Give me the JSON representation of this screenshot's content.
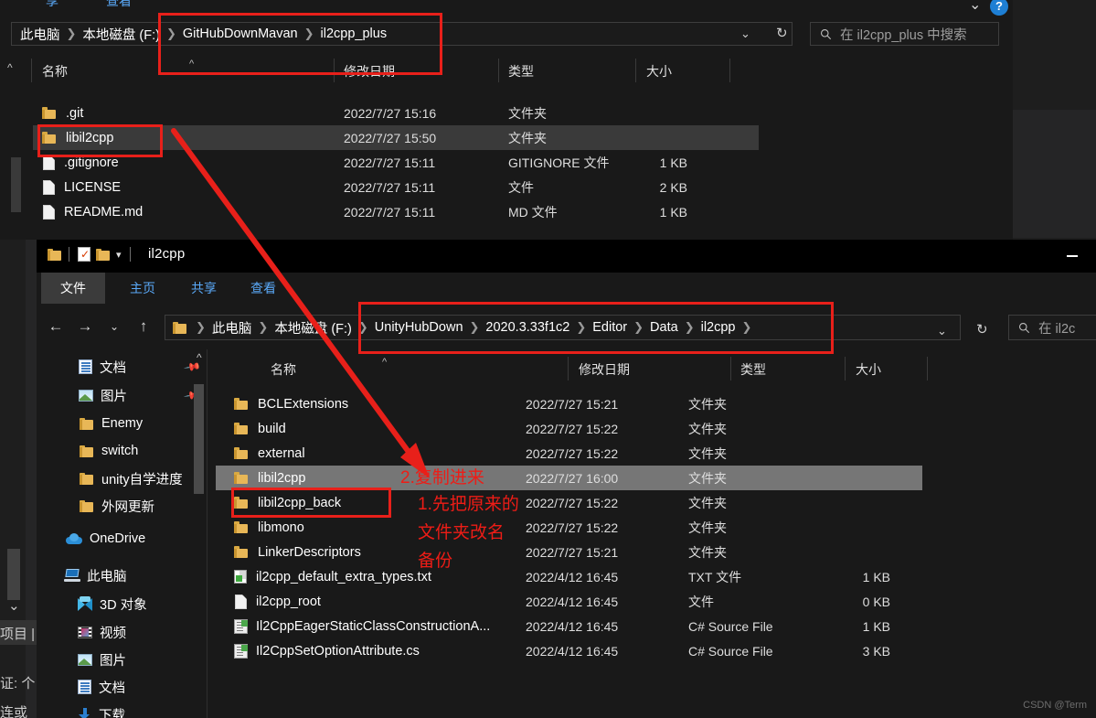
{
  "meta": {
    "watermark": "CSDN @Term"
  },
  "backdrop": {
    "edge_fragments": [
      {
        "text": "项目  |"
      },
      {
        "text": "证: 个"
      },
      {
        "text": "连或"
      }
    ]
  },
  "window_top": {
    "ribbon_tabs_visible": [
      "享",
      "查看"
    ],
    "help_icon": "?",
    "chevron_icon": "chevron-down-icon",
    "breadcrumbs": [
      "此电脑",
      "本地磁盘 (F:)",
      "GitHubDownMavan",
      "il2cpp_plus"
    ],
    "address_dropdown_icon": "chevron-down-icon",
    "refresh_icon": "refresh-icon",
    "search": {
      "icon": "search-icon",
      "placeholder": "在 il2cpp_plus 中搜索"
    },
    "columns": [
      "名称",
      "修改日期",
      "类型",
      "大小"
    ],
    "sort_indicator": "^",
    "rows": [
      {
        "name": ".git",
        "icon": "folder-icon",
        "date": "2022/7/27 15:16",
        "type": "文件夹",
        "size": "",
        "selected": false
      },
      {
        "name": "libil2cpp",
        "icon": "folder-icon",
        "date": "2022/7/27 15:50",
        "type": "文件夹",
        "size": "",
        "selected": true
      },
      {
        "name": ".gitignore",
        "icon": "file-icon",
        "date": "2022/7/27 15:11",
        "type": "GITIGNORE 文件",
        "size": "1 KB",
        "selected": false
      },
      {
        "name": "LICENSE",
        "icon": "file-icon",
        "date": "2022/7/27 15:11",
        "type": "文件",
        "size": "2 KB",
        "selected": false
      },
      {
        "name": "README.md",
        "icon": "file-icon",
        "date": "2022/7/27 15:11",
        "type": "MD 文件",
        "size": "1 KB",
        "selected": false
      }
    ]
  },
  "window_bottom": {
    "title": "il2cpp",
    "minimize_label": "—",
    "quick_access": [
      "folder-icon",
      "properties-icon",
      "new-folder-icon",
      "chevron-down-icon"
    ],
    "ribbon_tabs": [
      {
        "label": "文件",
        "active": true
      },
      {
        "label": "主页",
        "active": false
      },
      {
        "label": "共享",
        "active": false
      },
      {
        "label": "查看",
        "active": false
      }
    ],
    "nav_buttons": [
      "back-arrow-icon",
      "forward-arrow-icon",
      "recent-locations-icon",
      "up-arrow-icon"
    ],
    "breadcrumbs": [
      "此电脑",
      "本地磁盘 (F:)",
      "UnityHubDown",
      "2020.3.33f1c2",
      "Editor",
      "Data",
      "il2cpp"
    ],
    "address_dropdown_icon": "chevron-down-icon",
    "refresh_icon": "refresh-icon",
    "search": {
      "icon": "search-icon",
      "placeholder": "在 il2c"
    },
    "sidebar": [
      {
        "label": "文档",
        "icon": "documents-icon",
        "pinned": true,
        "indent": 1
      },
      {
        "label": "图片",
        "icon": "pictures-icon",
        "pinned": true,
        "indent": 1
      },
      {
        "label": "Enemy",
        "icon": "folder-icon",
        "pinned": false,
        "indent": 1
      },
      {
        "label": "switch",
        "icon": "folder-icon",
        "pinned": false,
        "indent": 1
      },
      {
        "label": "unity自学进度",
        "icon": "folder-icon",
        "pinned": false,
        "indent": 1
      },
      {
        "label": "外网更新",
        "icon": "folder-icon",
        "pinned": false,
        "indent": 1
      },
      {
        "label": "OneDrive",
        "icon": "onedrive-icon",
        "pinned": false,
        "indent": 0
      },
      {
        "label": "此电脑",
        "icon": "this-pc-icon",
        "pinned": false,
        "indent": 0
      },
      {
        "label": "3D 对象",
        "icon": "3d-objects-icon",
        "pinned": false,
        "indent": 1
      },
      {
        "label": "视频",
        "icon": "videos-icon",
        "pinned": false,
        "indent": 1
      },
      {
        "label": "图片",
        "icon": "pictures-icon",
        "pinned": false,
        "indent": 1
      },
      {
        "label": "文档",
        "icon": "documents-icon",
        "pinned": false,
        "indent": 1
      },
      {
        "label": "下载",
        "icon": "downloads-icon",
        "pinned": false,
        "indent": 1
      }
    ],
    "columns": [
      "名称",
      "修改日期",
      "类型",
      "大小"
    ],
    "sort_indicator": "^",
    "rows": [
      {
        "name": "BCLExtensions",
        "icon": "folder-icon",
        "date": "2022/7/27 15:21",
        "type": "文件夹",
        "size": "",
        "selected": false
      },
      {
        "name": "build",
        "icon": "folder-icon",
        "date": "2022/7/27 15:22",
        "type": "文件夹",
        "size": "",
        "selected": false
      },
      {
        "name": "external",
        "icon": "folder-icon",
        "date": "2022/7/27 15:22",
        "type": "文件夹",
        "size": "",
        "selected": false
      },
      {
        "name": "libil2cpp",
        "icon": "folder-icon",
        "date": "2022/7/27 16:00",
        "type": "文件夹",
        "size": "",
        "selected": true
      },
      {
        "name": "libil2cpp_back",
        "icon": "folder-icon",
        "date": "2022/7/27 15:22",
        "type": "文件夹",
        "size": "",
        "selected": false
      },
      {
        "name": "libmono",
        "icon": "folder-icon",
        "date": "2022/7/27 15:22",
        "type": "文件夹",
        "size": "",
        "selected": false
      },
      {
        "name": "LinkerDescriptors",
        "icon": "folder-icon",
        "date": "2022/7/27 15:21",
        "type": "文件夹",
        "size": "",
        "selected": false
      },
      {
        "name": "il2cpp_default_extra_types.txt",
        "icon": "txt-icon",
        "date": "2022/4/12 16:45",
        "type": "TXT 文件",
        "size": "1 KB",
        "selected": false
      },
      {
        "name": "il2cpp_root",
        "icon": "file-icon",
        "date": "2022/4/12 16:45",
        "type": "文件",
        "size": "0 KB",
        "selected": false
      },
      {
        "name": "Il2CppEagerStaticClassConstructionA...",
        "icon": "cs-icon",
        "date": "2022/4/12 16:45",
        "type": "C# Source File",
        "size": "1 KB",
        "selected": false
      },
      {
        "name": "Il2CppSetOptionAttribute.cs",
        "icon": "cs-icon",
        "date": "2022/4/12 16:45",
        "type": "C# Source File",
        "size": "3 KB",
        "selected": false
      }
    ]
  },
  "annotations": {
    "color": "#e8201a",
    "notes": [
      {
        "id": "note-copy-in",
        "lines": [
          "2.复制进来"
        ]
      },
      {
        "id": "note-rename",
        "lines": [
          "1.先把原来的",
          "文件夹改名",
          "备份"
        ]
      }
    ],
    "boxes": [
      {
        "id": "box-top-breadcrumb"
      },
      {
        "id": "box-top-libil2cpp"
      },
      {
        "id": "box-bottom-breadcrumb"
      },
      {
        "id": "box-bottom-libil2cpp-back"
      }
    ],
    "arrow": {
      "id": "copy-arrow",
      "from": "libil2cpp (il2cpp_plus)",
      "to": "libil2cpp (il2cpp)"
    }
  }
}
